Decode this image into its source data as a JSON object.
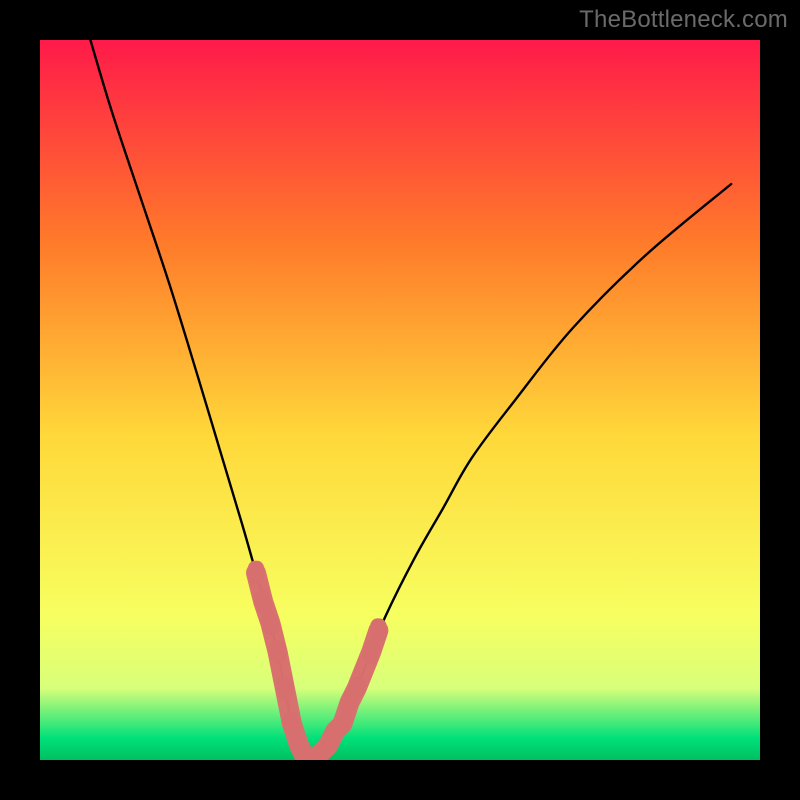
{
  "attribution": "TheBottleneck.com",
  "colors": {
    "frame": "#000000",
    "gradient_top": "#ff1a4a",
    "gradient_upper_mid": "#ff7a2a",
    "gradient_mid": "#ffd83a",
    "gradient_lower_mid": "#f7ff60",
    "gradient_low": "#d8ff7a",
    "gradient_bottom": "#00e07a",
    "gradient_bottom_edge": "#00c060",
    "curve": "#000000",
    "marker": "#d86f6f",
    "marker_line": "#d86f6f"
  },
  "chart_data": {
    "type": "line",
    "title": "",
    "xlabel": "",
    "ylabel": "",
    "xlim": [
      0,
      100
    ],
    "ylim": [
      0,
      100
    ],
    "grid": false,
    "legend": false,
    "series": [
      {
        "name": "bottleneck-curve",
        "x": [
          7,
          10,
          14,
          18,
          22,
          25,
          28,
          30,
          32,
          33,
          34,
          35,
          36,
          37,
          38,
          40,
          42,
          44,
          46,
          48,
          52,
          56,
          60,
          66,
          74,
          84,
          96
        ],
        "y": [
          100,
          90,
          78,
          66,
          53,
          43,
          33,
          26,
          19,
          15,
          10,
          5,
          2,
          0,
          0,
          2,
          5,
          10,
          15,
          20,
          28,
          35,
          42,
          50,
          60,
          70,
          80
        ]
      }
    ],
    "markers": {
      "name": "highlighted-points",
      "x": [
        30,
        31,
        32,
        33,
        34,
        35,
        36,
        37,
        38,
        40,
        41,
        42,
        43,
        44,
        46,
        47
      ],
      "y": [
        26,
        22,
        19,
        15,
        10,
        5,
        2,
        0,
        0,
        2,
        4,
        5,
        8,
        10,
        15,
        18
      ]
    },
    "vertex": {
      "x": 37,
      "y": 0
    }
  }
}
